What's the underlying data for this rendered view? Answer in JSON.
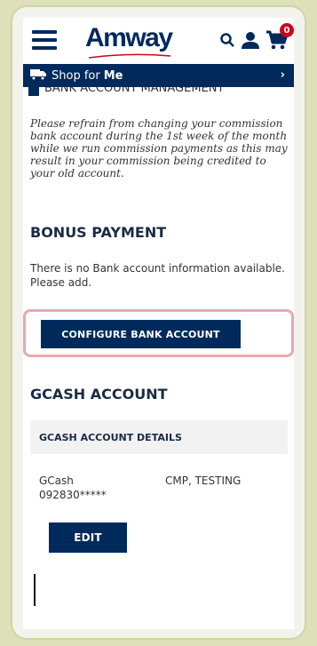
{
  "header": {
    "logo": "Amway",
    "cart_count": "0"
  },
  "shopbar": {
    "prefix": "Shop for",
    "target": "Me",
    "chevron": "›"
  },
  "bank_mgmt": {
    "title": "BANK ACCOUNT MANAGEMENT",
    "notice": "Please refrain from changing your commission bank account during the 1st week of the month while we run commission payments as this may result in your commission being credited to your old account."
  },
  "bonus": {
    "title": "BONUS PAYMENT",
    "message": "There is no Bank account information available. Please add.",
    "configure_label": "CONFIGURE BANK ACCOUNT"
  },
  "gcash": {
    "title": "GCASH ACCOUNT",
    "details_header": "GCASH ACCOUNT DETAILS",
    "provider": "GCash",
    "number": "092830*****",
    "holder": "CMP, TESTING",
    "edit_label": "EDIT"
  },
  "colors": {
    "brand_navy": "#002a5c",
    "highlight_border": "#e6aab0",
    "badge_red": "#d0021b",
    "frame": "#dde0b8"
  },
  "icons": [
    "menu-icon",
    "search-icon",
    "account-icon",
    "cart-icon",
    "truck-icon",
    "chevron-right-icon"
  ]
}
